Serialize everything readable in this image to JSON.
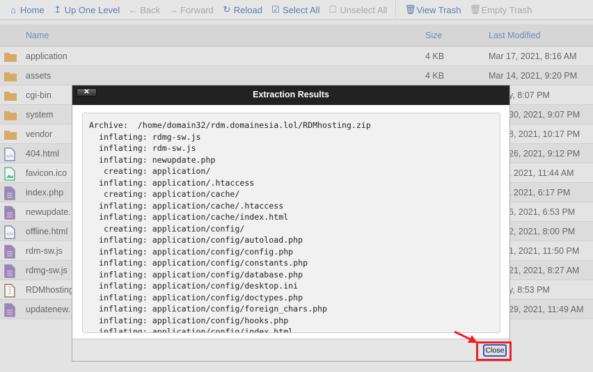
{
  "toolbar": {
    "items": [
      {
        "label": "Home",
        "icon": "home-icon",
        "enabled": true
      },
      {
        "label": "Up One Level",
        "icon": "arrow-up-icon",
        "enabled": true
      },
      {
        "label": "Back",
        "icon": "arrow-left-icon",
        "enabled": false
      },
      {
        "label": "Forward",
        "icon": "arrow-right-icon",
        "enabled": false
      },
      {
        "label": "Reload",
        "icon": "reload-icon",
        "enabled": true
      },
      {
        "label": "Select All",
        "icon": "checkbox-checked-icon",
        "enabled": true
      },
      {
        "label": "Unselect All",
        "icon": "checkbox-empty-icon",
        "enabled": false
      },
      {
        "label": "View Trash",
        "icon": "trash-icon",
        "enabled": true
      },
      {
        "label": "Empty Trash",
        "icon": "trash-icon",
        "enabled": false
      }
    ]
  },
  "table": {
    "headers": {
      "name": "Name",
      "size": "Size",
      "modified": "Last Modified"
    },
    "rows": [
      {
        "name": "application",
        "type": "folder",
        "size": "4 KB",
        "modified": "Mar 17, 2021, 8:16 AM"
      },
      {
        "name": "assets",
        "type": "folder",
        "size": "4 KB",
        "modified": "Mar 14, 2021, 9:20 PM"
      },
      {
        "name": "cgi-bin",
        "type": "folder",
        "modified_partial": "y, 8:07 PM"
      },
      {
        "name": "system",
        "type": "folder",
        "modified_partial": "30, 2021, 9:07 PM"
      },
      {
        "name": "vendor",
        "type": "folder",
        "modified_partial": "8, 2021, 10:17 PM"
      },
      {
        "name": "404.html",
        "type": "html",
        "modified_partial": "26, 2021, 9:12 PM"
      },
      {
        "name": "favicon.ico",
        "type": "image",
        "modified_partial": ", 2021, 11:44 AM"
      },
      {
        "name": "index.php",
        "type": "text",
        "modified_partial": ", 2021, 6:17 PM"
      },
      {
        "name": "newupdate.",
        "type": "text",
        "modified_partial": "6, 2021, 6:53 PM"
      },
      {
        "name": "offline.html",
        "type": "html",
        "modified_partial": "2, 2021, 8:00 PM"
      },
      {
        "name": "rdm-sw.js",
        "type": "text",
        "modified_partial": "1, 2021, 11:50 PM"
      },
      {
        "name": "rdmg-sw.js",
        "type": "text",
        "modified_partial": "21, 2021, 8:27 AM"
      },
      {
        "name": "RDMhosting",
        "type": "zip",
        "modified_partial": "y, 8:53 PM"
      },
      {
        "name": "updatenew.",
        "type": "text",
        "modified_partial": "29, 2021, 11:49 AM"
      }
    ]
  },
  "modal": {
    "title": "Extraction Results",
    "close_x": "✕",
    "close_label": "Close",
    "lines": [
      "Archive:  /home/domain32/rdm.domainesia.lol/RDMhosting.zip",
      "  inflating: rdmg-sw.js",
      "  inflating: rdm-sw.js",
      "  inflating: newupdate.php",
      "   creating: application/",
      "  inflating: application/.htaccess",
      "   creating: application/cache/",
      "  inflating: application/cache/.htaccess",
      "  inflating: application/cache/index.html",
      "   creating: application/config/",
      "  inflating: application/config/autoload.php",
      "  inflating: application/config/config.php",
      "  inflating: application/config/constants.php",
      "  inflating: application/config/database.php",
      "  inflating: application/config/desktop.ini",
      "  inflating: application/config/doctypes.php",
      "  inflating: application/config/foreign_chars.php",
      "  inflating: application/config/hooks.php",
      "  inflating: application/config/index.html"
    ]
  },
  "colors": {
    "highlight": "#e22222",
    "link": "#5b80b0",
    "title_bar": "#222222"
  }
}
